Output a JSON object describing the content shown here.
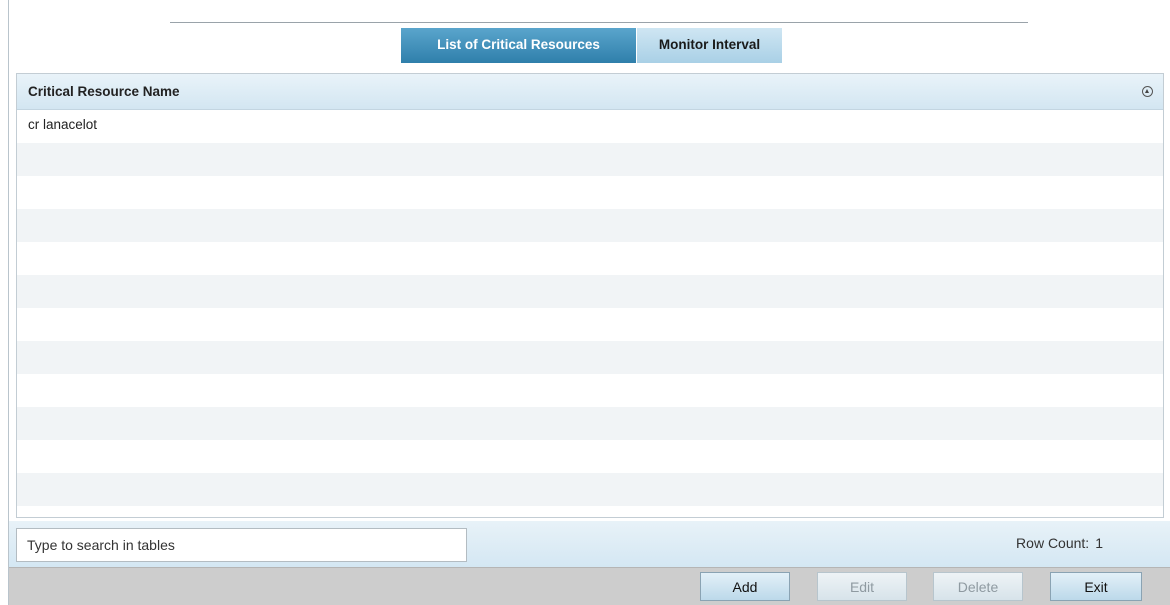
{
  "tabs": [
    {
      "label": "List of Critical Resources",
      "active": true
    },
    {
      "label": "Monitor Interval",
      "active": false
    }
  ],
  "table": {
    "columns": [
      "Critical Resource Name"
    ],
    "rows": [
      [
        "cr lanacelot"
      ]
    ]
  },
  "search": {
    "placeholder": "Type to search in tables",
    "value": ""
  },
  "row_count": {
    "label": "Row Count:",
    "value": "1"
  },
  "buttons": {
    "add": "Add",
    "edit": "Edit",
    "delete": "Delete",
    "exit": "Exit"
  },
  "colors": {
    "active_tab": "#2f7fab",
    "inactive_tab": "#a9d0e6",
    "header_bg": "#d3e6f2",
    "action_bar": "#cdcdcd"
  }
}
